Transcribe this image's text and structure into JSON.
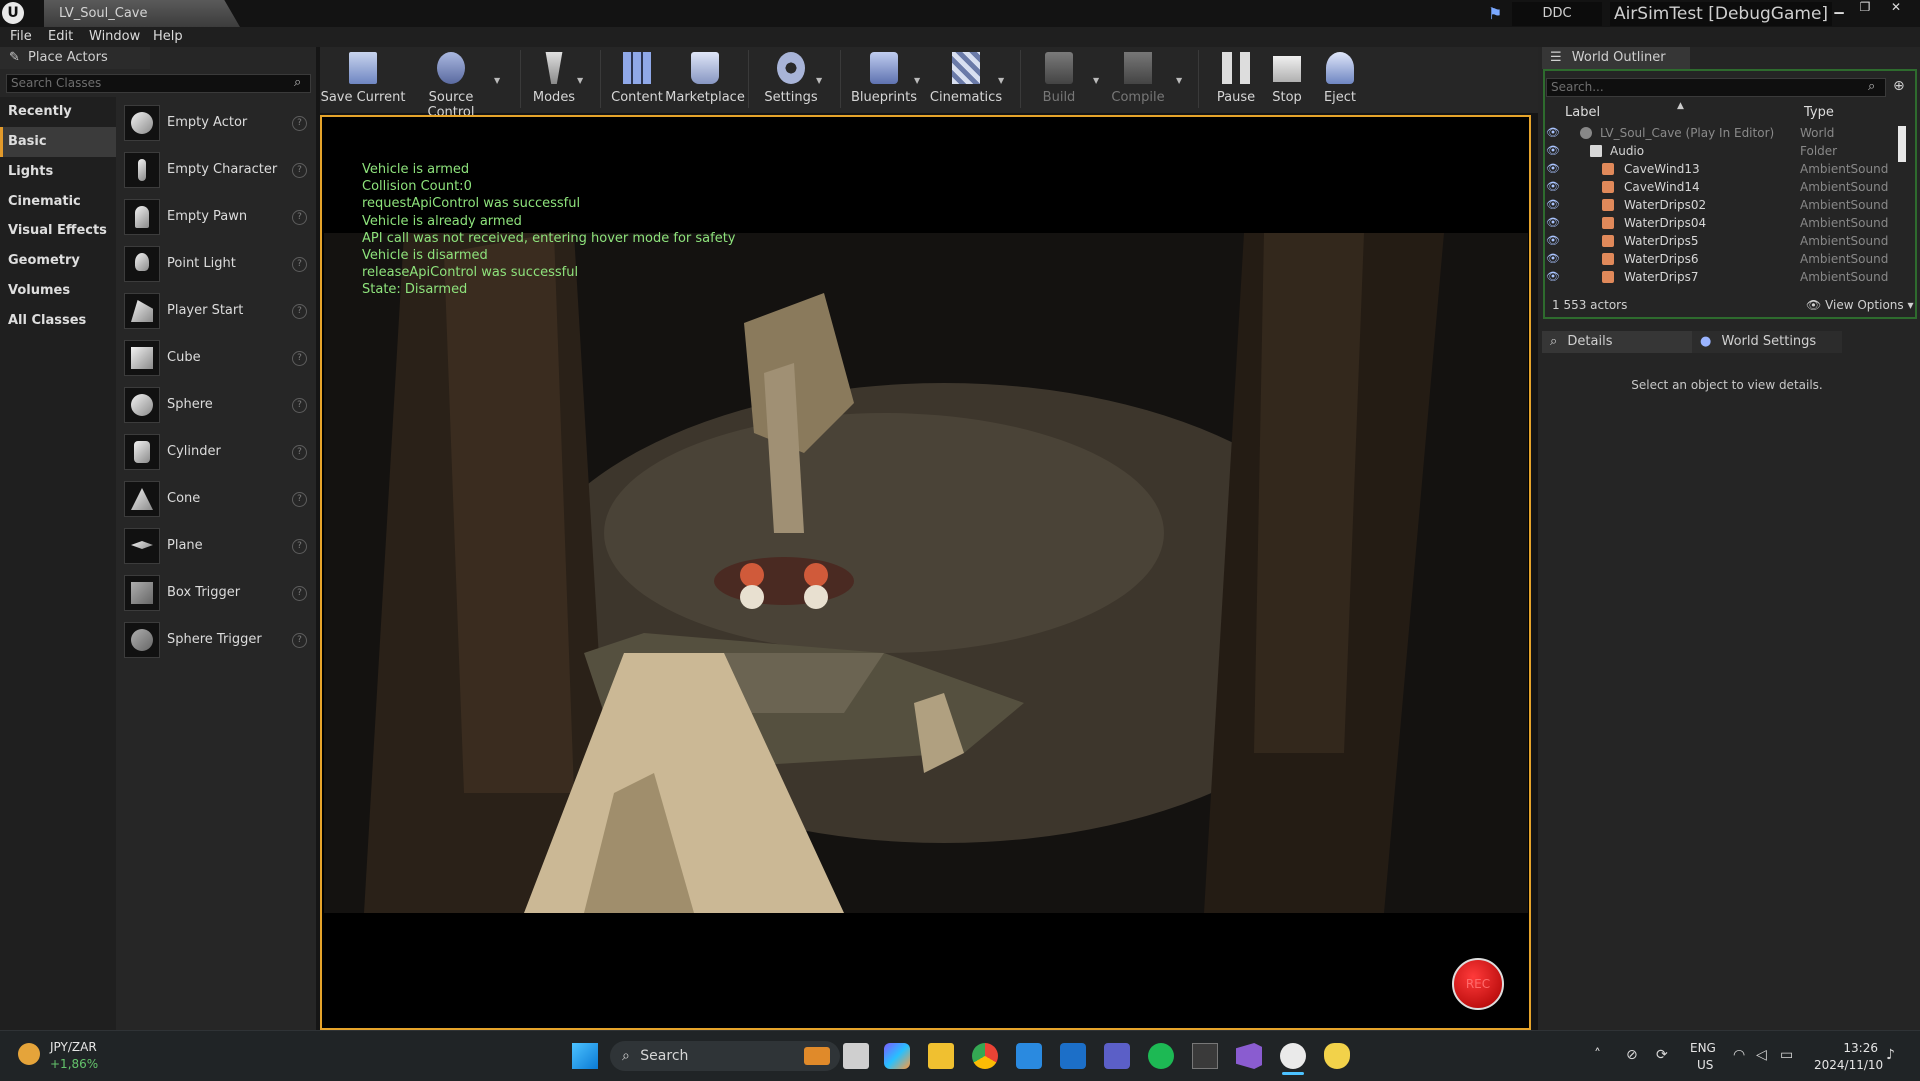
{
  "titlebar": {
    "logo": "U",
    "document_tab": "LV_Soul_Cave",
    "ddc": "DDC",
    "project": "AirSimTest [DebugGame]"
  },
  "menu": [
    "File",
    "Edit",
    "Window",
    "Help"
  ],
  "place_actors": {
    "tab": "Place Actors",
    "search_placeholder": "Search Classes",
    "categories": [
      "Recently Placed",
      "Basic",
      "Lights",
      "Cinematic",
      "Visual Effects",
      "Geometry",
      "Volumes",
      "All Classes"
    ],
    "selected_category": "Basic",
    "actors": [
      "Empty Actor",
      "Empty Character",
      "Empty Pawn",
      "Point Light",
      "Player Start",
      "Cube",
      "Sphere",
      "Cylinder",
      "Cone",
      "Plane",
      "Box Trigger",
      "Sphere Trigger"
    ]
  },
  "toolbar": [
    "Save Current",
    "Source Control",
    "Modes",
    "Content",
    "Marketplace",
    "Settings",
    "Blueprints",
    "Cinematics",
    "Build",
    "Compile",
    "Pause",
    "Stop",
    "Eject"
  ],
  "viewport": {
    "messages": [
      "Vehicle is armed",
      "Collision Count:0",
      "requestApiControl was successful",
      "Vehicle is already armed",
      "API call was not received, entering hover mode for safety",
      "Vehicle is disarmed",
      "releaseApiControl was successful",
      "State: Disarmed"
    ],
    "rec_label": "REC",
    "accent_color": "#e6a42b"
  },
  "outliner": {
    "tab": "World Outliner",
    "search_placeholder": "Search...",
    "col_label": "Label",
    "col_type": "Type",
    "rows": [
      {
        "label": "LV_Soul_Cave (Play In Editor)",
        "type": "World"
      },
      {
        "label": "Audio",
        "type": "Folder"
      },
      {
        "label": "CaveWind13",
        "type": "AmbientSound"
      },
      {
        "label": "CaveWind14",
        "type": "AmbientSound"
      },
      {
        "label": "WaterDrips02",
        "type": "AmbientSound"
      },
      {
        "label": "WaterDrips04",
        "type": "AmbientSound"
      },
      {
        "label": "WaterDrips5",
        "type": "AmbientSound"
      },
      {
        "label": "WaterDrips6",
        "type": "AmbientSound"
      },
      {
        "label": "WaterDrips7",
        "type": "AmbientSound"
      }
    ],
    "actor_count": "1 553 actors",
    "view_options": "View Options"
  },
  "details": {
    "tab": "Details",
    "world_settings_tab": "World Settings",
    "empty_text": "Select an object to view details."
  },
  "taskbar": {
    "stock_label": "JPY/ZAR",
    "stock_change": "+1,86%",
    "search_label": "Search",
    "lang_line1": "ENG",
    "lang_line2": "US",
    "time": "13:26",
    "date": "2024/11/10"
  }
}
